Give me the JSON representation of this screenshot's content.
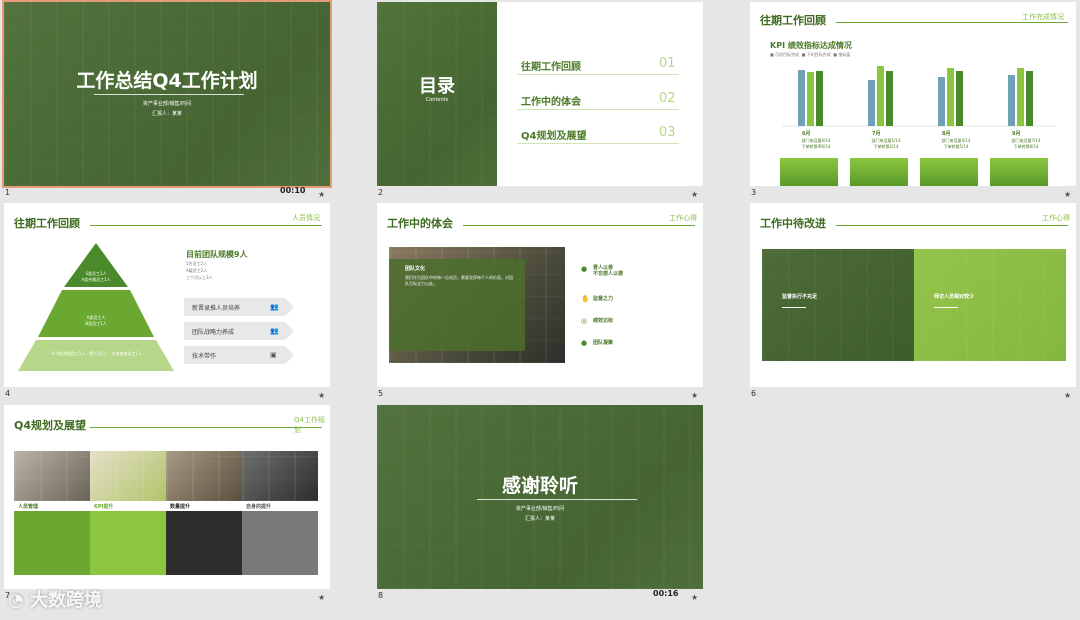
{
  "slides": [
    {
      "num": "1",
      "title": "工作总结Q4工作计划",
      "subtitle": "资产事业部/销售/时间",
      "reporter": "汇报人：某某",
      "timer": "00:10"
    },
    {
      "num": "2",
      "title": "目录",
      "subtitle": "Contents",
      "items": [
        {
          "label": "往期工作回顾",
          "no": "01"
        },
        {
          "label": "工作中的体会",
          "no": "02"
        },
        {
          "label": "Q4规划及展望",
          "no": "03"
        }
      ]
    },
    {
      "num": "3",
      "title": "往期工作回顾",
      "tag": "工作完成情况",
      "chart_title": "KPI 绩效指标达成情况",
      "legend": [
        "■ 月初目标完成",
        "■ 下旬目标完成",
        "■ 指标值"
      ],
      "months": [
        "6月",
        "7月",
        "8月",
        "9月"
      ],
      "notes": [
        "部门电话量6/14\n下单转换率6/14",
        "部门电话量1/14\n下单转换2/14",
        "部门电话量4/14\n下单转换5/14",
        "部门电话量7/14\n下单转换8/14"
      ]
    },
    {
      "num": "4",
      "title": "往期工作回顾",
      "tag": "人员情况",
      "team": "目前团队规模9人",
      "team_details": [
        "5名员工2人",
        "A级员工2人",
        "三个月以上3人"
      ],
      "pyr": [
        "S类员工1人\nA类合格员工1人",
        "A类员工人\nB类员工1人",
        "B A类合格员工1人 · 第三月1人 · 业务结束员工1人"
      ],
      "actions": [
        "新晋录推人员培养",
        "团队战略力养成",
        "技术带作"
      ]
    },
    {
      "num": "5",
      "title": "工作中的体会",
      "tag": "工作心得",
      "box_title": "团队文化",
      "box_body": "我们作为团队中的每一位成员，需要发挥每个人的价值，对团队目标全力以赴。",
      "points": [
        {
          "t": "晋人以善\n不忘感人以德"
        },
        {
          "t": "监督之力"
        },
        {
          "t": "绩效达标"
        },
        {
          "t": "团队凝聚"
        }
      ]
    },
    {
      "num": "6",
      "title": "工作中待改进",
      "tag": "工作心得",
      "left": "监督执行不充足",
      "right": "拜访人员相对较少"
    },
    {
      "num": "7",
      "title": "Q4规划及展望",
      "tag": "Q4工作规划",
      "cols": [
        {
          "h": "人员管理",
          "c": "#6aa832"
        },
        {
          "h": "KPI提升",
          "c": "#8cc63f"
        },
        {
          "h": "数量提升",
          "c": "#2e2e2e"
        },
        {
          "h": "自身的提升",
          "c": "#7a7a7a"
        }
      ]
    },
    {
      "num": "8",
      "title": "感谢聆听",
      "subtitle": "资产事业部/销售/时间",
      "reporter": "汇报人：某某",
      "timer": "00:16"
    }
  ],
  "watermark": "大数跨境",
  "star": "★"
}
